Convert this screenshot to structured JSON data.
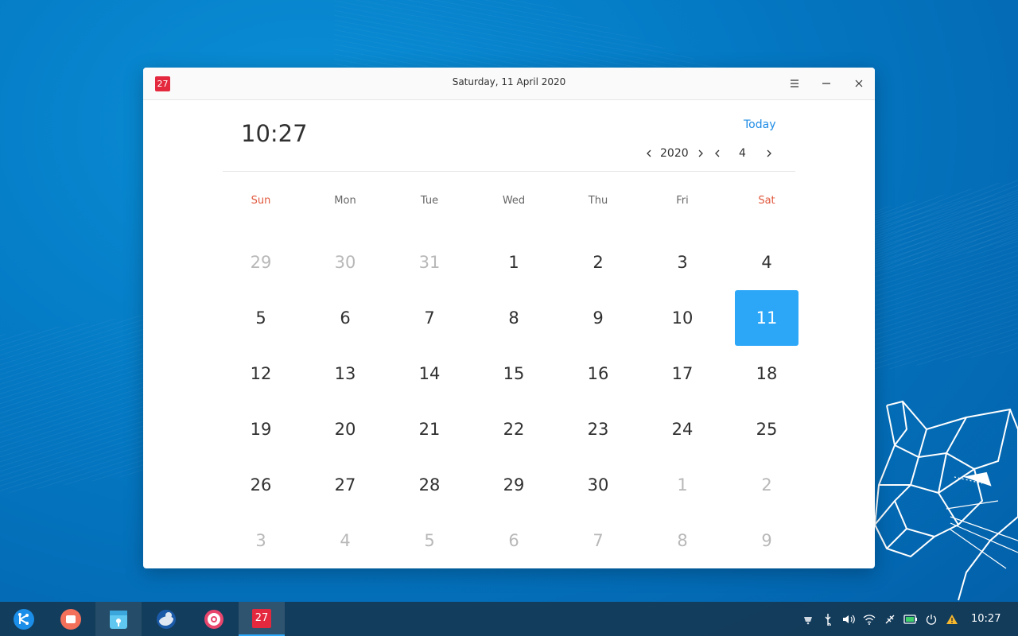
{
  "window": {
    "title": "Saturday, 11 April 2020",
    "icon_text": "27"
  },
  "header": {
    "time": "10:27",
    "today_label": "Today",
    "year": "2020",
    "month": "4"
  },
  "weekdays": [
    "Sun",
    "Mon",
    "Tue",
    "Wed",
    "Thu",
    "Fri",
    "Sat"
  ],
  "days": [
    {
      "n": "29",
      "other": true
    },
    {
      "n": "30",
      "other": true
    },
    {
      "n": "31",
      "other": true
    },
    {
      "n": "1"
    },
    {
      "n": "2"
    },
    {
      "n": "3"
    },
    {
      "n": "4"
    },
    {
      "n": "5"
    },
    {
      "n": "6"
    },
    {
      "n": "7"
    },
    {
      "n": "8"
    },
    {
      "n": "9"
    },
    {
      "n": "10"
    },
    {
      "n": "11",
      "selected": true
    },
    {
      "n": "12"
    },
    {
      "n": "13"
    },
    {
      "n": "14"
    },
    {
      "n": "15"
    },
    {
      "n": "16"
    },
    {
      "n": "17"
    },
    {
      "n": "18"
    },
    {
      "n": "19"
    },
    {
      "n": "20"
    },
    {
      "n": "21"
    },
    {
      "n": "22"
    },
    {
      "n": "23"
    },
    {
      "n": "24"
    },
    {
      "n": "25"
    },
    {
      "n": "26"
    },
    {
      "n": "27"
    },
    {
      "n": "28"
    },
    {
      "n": "29"
    },
    {
      "n": "30"
    },
    {
      "n": "1",
      "other": true
    },
    {
      "n": "2",
      "other": true
    },
    {
      "n": "3",
      "other": true
    },
    {
      "n": "4",
      "other": true
    },
    {
      "n": "5",
      "other": true
    },
    {
      "n": "6",
      "other": true
    },
    {
      "n": "7",
      "other": true
    },
    {
      "n": "8",
      "other": true
    },
    {
      "n": "9",
      "other": true
    }
  ],
  "taskbar": {
    "apps": [
      "launcher-icon",
      "multitask-icon",
      "app-store-icon",
      "mail-client-icon",
      "control-center-icon",
      "calendar-icon"
    ],
    "calendar_icon_text": "27",
    "clock": "10:27"
  },
  "colors": {
    "accent": "#2ca7f8",
    "weekend": "#e0583d",
    "link": "#1f8ce6"
  }
}
